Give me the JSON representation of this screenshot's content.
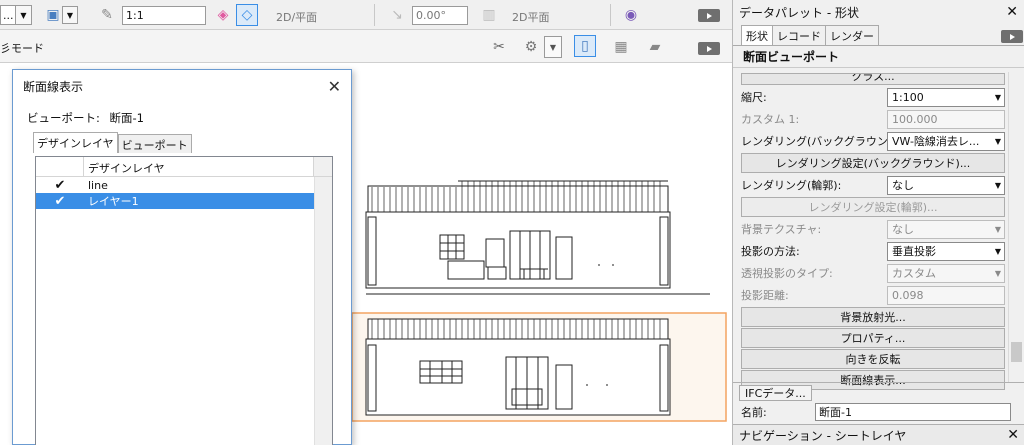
{
  "toolbar1": {
    "class_combo": "...",
    "scale_value": "1:1",
    "view_label": "2D/平面",
    "angle_value": "0.00°",
    "plane_label": "2D平面"
  },
  "toolbar2": {
    "mode_label": "彡モード"
  },
  "dialog": {
    "title": "断面線表示",
    "viewport_label": "ビューポート:",
    "viewport_value": "断面-1",
    "tabs": [
      "デザインレイヤ",
      "ビューポート"
    ],
    "column_header": "デザインレイヤ",
    "rows": [
      {
        "check": "✔",
        "name": "line",
        "selected": false
      },
      {
        "check": "✔",
        "name": "レイヤー1",
        "selected": true
      }
    ]
  },
  "palette": {
    "title": "データパレット - 形状",
    "tabs": [
      "形状",
      "レコード",
      "レンダー"
    ],
    "section_title": "断面ビューポート",
    "top_button": "クラス...",
    "scale_label": "縮尺:",
    "scale_value": "1:100",
    "custom_label": "カスタム 1:",
    "custom_value": "100.000",
    "bg_render_label": "レンダリング(バックグラウンド):",
    "bg_render_value": "VW-陰線消去レ...",
    "bg_render_settings": "レンダリング設定(バックグラウンド)...",
    "outline_render_label": "レンダリング(輪郭):",
    "outline_render_value": "なし",
    "outline_render_settings": "レンダリング設定(輪郭)...",
    "bg_texture_label": "背景テクスチャ:",
    "bg_texture_value": "なし",
    "projection_label": "投影の方法:",
    "projection_value": "垂直投影",
    "perspective_label": "透視投影のタイプ:",
    "perspective_value": "カスタム",
    "proj_distance_label": "投影距離:",
    "proj_distance_value": "0.098",
    "btn_bg_radiosity": "背景放射光...",
    "btn_properties": "プロパティ...",
    "btn_flip": "向きを反転",
    "btn_section_display": "断面線表示...",
    "ifc_button": "IFCデータ...",
    "name_label": "名前:",
    "name_value": "断面-1",
    "nav_title": "ナビゲーション - シートレイヤ"
  },
  "colors": {
    "selection": "#3a8ee6",
    "highlight_frame": "#f4a460",
    "accent_icon": "#e05aa0"
  }
}
